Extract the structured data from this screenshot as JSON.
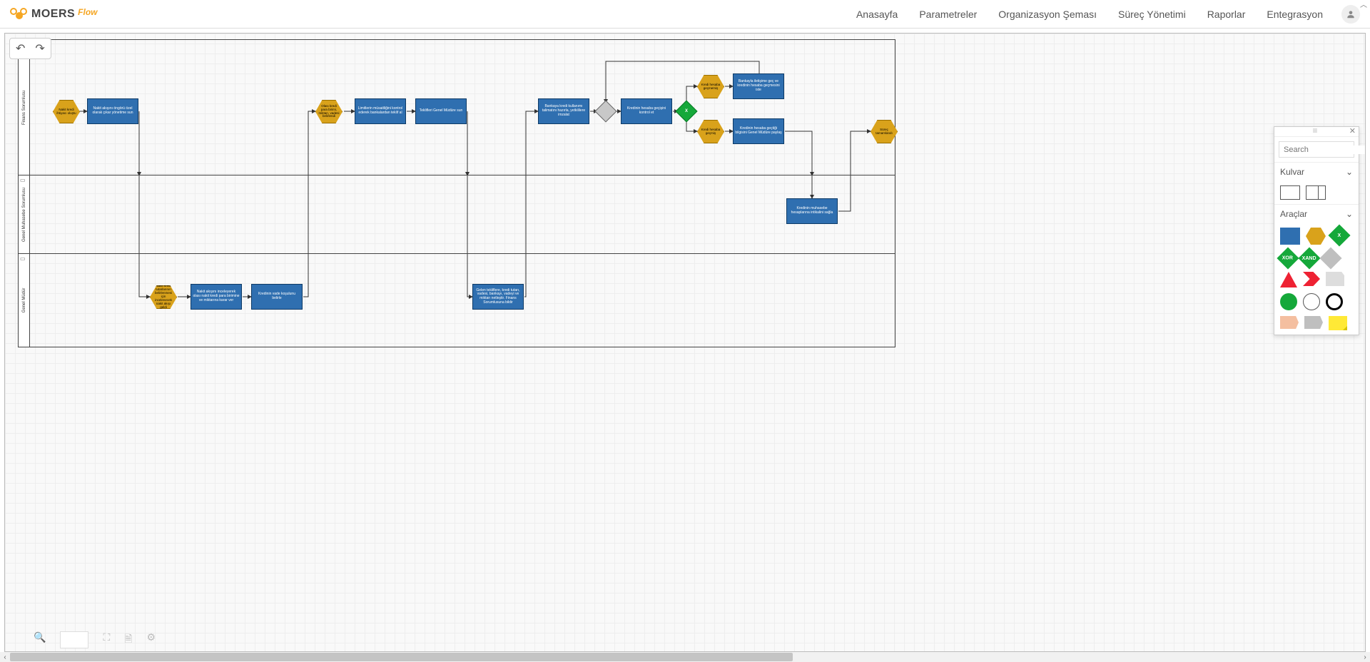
{
  "brand": {
    "name": "MOERS",
    "product": "Flow"
  },
  "nav": {
    "home": "Anasayfa",
    "params": "Parametreler",
    "org": "Organizasyon Şeması",
    "process": "Süreç Yönetimi",
    "reports": "Raporlar",
    "integration": "Entegrasyon"
  },
  "lanes": {
    "l1": "Finans Sorumlusu",
    "l2": "Genel Muhasebe Sorumlusu",
    "l3": "Genel Müdür"
  },
  "nodes": {
    "h1": "Nakit kredi ihtiyacı oluştu",
    "t1": "Nakit akışını öngörü özel olarak çıkar yönetime sun",
    "h2": "Olası kredi para birimi, miktarı, vadesi belirlendi",
    "t2": "Limitlerin müsaitliğini kontrol ederek bankalardan teklif al",
    "t3": "Teklifleri Genel Müdüre sun",
    "t4": "Bankaya kredi kullanımı talimatını hazırla, yetkililere imzalat",
    "gw1": "",
    "t5": "Kredinin hesaba geçişini kontrol et",
    "gw2": "X",
    "h3": "Kredi hesaba geçmemiş",
    "t6": "Bankayla iletişime geç ve kredinin hesaba geçmesini iste",
    "h4": "Kredi hesaba geçmiş",
    "t7": "Kredinin hesaba geçtiği bilgisini Genel Müdüre paylaş",
    "hEnd": "Süreç tamamlandı",
    "t8": "Kredinin muhasebe hesaplarına intikalini sağla",
    "h5": "Nakit kredi tutarlarının belirlenmesi için incelenecek nakit akışı geldi",
    "t9": "Nakit akışını inceleyerek olası nakit kredi para birimine ve miktarına karar ver",
    "t10": "Kredinin vade koşulunu belirle",
    "t11": "Gelen tekliflere, kredi tutarı, vadesi, bankayı, vadeyi ve miktarı netleştir. Finans Sorumlusuna bildir"
  },
  "palette": {
    "search_ph": "Search",
    "sec1": "Kulvar",
    "sec2": "Araçlar",
    "xor": "XOR",
    "xand": "XAND",
    "x": "X"
  }
}
